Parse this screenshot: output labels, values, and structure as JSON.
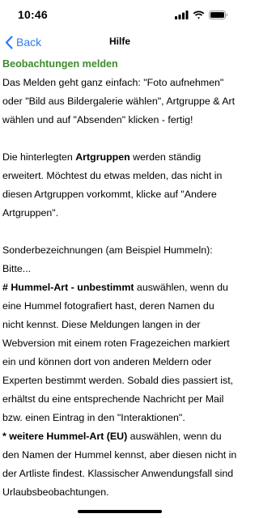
{
  "status_bar": {
    "time": "10:46",
    "icons": [
      "signal-icon",
      "wifi-icon",
      "battery-icon"
    ]
  },
  "nav": {
    "back_label": "Back",
    "title": "Hilfe",
    "accent_color": "#2a7cf6"
  },
  "section": {
    "title": "Beobachtungen melden",
    "title_color": "#3e8b2b"
  },
  "paragraphs": {
    "p1": "Das Melden geht ganz einfach: \"Foto aufnehmen\" oder \"Bild aus Bildergalerie wählen\", Artgruppe & Art wählen und auf \"Absenden\" klicken - fertig!",
    "p2_before": "Die hinterlegten ",
    "p2_bold": "Artgruppen",
    "p2_after": " werden ständig erweitert. Möchtest du etwas melden, das nicht in diesen Artgruppen vorkommt, klicke auf \"Andere Artgruppen\".",
    "p3": "Sonderbezeichnungen (am Beispiel Hummeln): Bitte...",
    "p4_bold": "# Hummel-Art - unbestimmt",
    "p4_after": " auswählen, wenn du eine Hummel fotografiert hast, deren Namen du nicht kennst. Diese Meldungen langen in der Webversion mit einem roten Fragezeichen markiert ein und können dort von anderen Meldern oder Experten bestimmt werden. Sobald dies passiert ist, erhältst du eine entsprechende Nachricht per Mail bzw. einen Eintrag in den \"Interaktionen\".",
    "p5_bold": "* weitere Hummel-Art (EU)",
    "p5_after": " auswählen, wenn du den Namen der Hummel kennst, aber diesen nicht in der Artliste findest. Klassischer Anwendungsfall sind Urlaubsbeobachtungen."
  }
}
